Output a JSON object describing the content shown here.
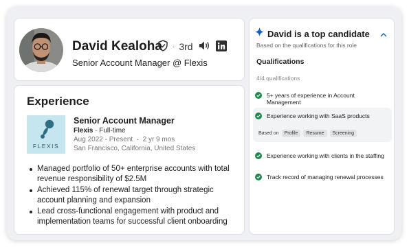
{
  "profile": {
    "name": "David Kealoha",
    "separator": "·",
    "degree": "3rd",
    "headline": "Senior Account Manager @ Flexis"
  },
  "experience": {
    "section_title": "Experience",
    "job": {
      "title": "Senior Account Manager",
      "company": "Flexis",
      "employment_type": "· Full-time",
      "dates": "Aug 2022 - Present  ·  2 yr 9 mos",
      "location": "San Francisco, California, United States",
      "logo_text": "FLEXIS"
    },
    "bullets": [
      "Managed portfolio of 50+ enterprise accounts with total revenue responsibility of $2.5M",
      "Achieved 115% of renewal target through strategic account planning and expansion",
      "Lead cross-functional engagement with product and implementation teams for successful client onboarding"
    ]
  },
  "candidate": {
    "title": "David is a top candidate",
    "subtitle": "Based on the qualifications for this role",
    "qualifications_title": "Qualifications",
    "count": "4/4 qualifications",
    "items": [
      "5+ years of experience in Account Management",
      "Experience working with SaaS products",
      "Experience working with clients in the staffing",
      "Track record of managing renewal processes"
    ],
    "based_on_label": "Based on",
    "based_on_chips": [
      "Profile",
      "Resume",
      "Screening"
    ]
  },
  "colors": {
    "accent": "#0a66c2",
    "check_green": "#1f8a4c",
    "logo_bg": "#c5e5ef"
  },
  "icons": [
    "shield-icon",
    "speaker-icon",
    "linkedin-icon",
    "sparkle-icon",
    "chevron-up-icon",
    "check-circle-icon"
  ]
}
